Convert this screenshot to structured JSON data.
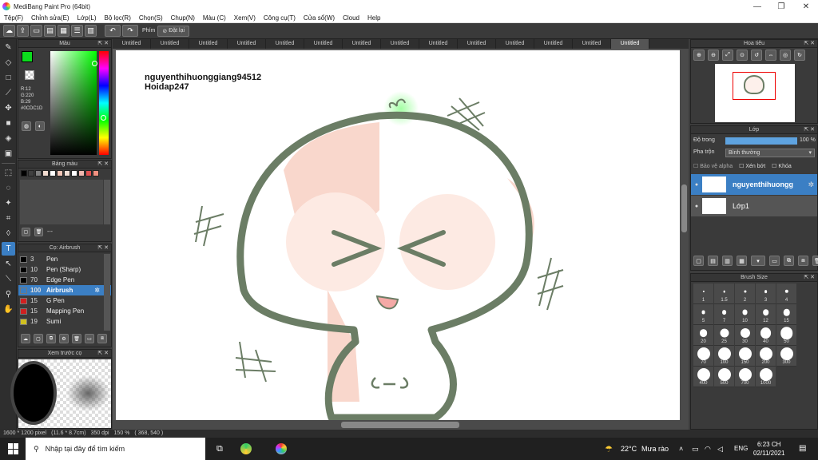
{
  "window": {
    "title": "MediBang Paint Pro (64bit)"
  },
  "menu": [
    "Tệp(F)",
    "Chỉnh sửa(E)",
    "Lớp(L)",
    "Bộ lọc(R)",
    "Chọn(S)",
    "Chụp(N)",
    "Màu (C)",
    "Xem(V)",
    "Công cụ(T)",
    "Cửa sổ(W)",
    "Cloud",
    "Help"
  ],
  "toolbar": {
    "phim_label": "Phím",
    "reset_label": "Đặt lại"
  },
  "doc_tabs": [
    "Untitled",
    "Untitled",
    "Untitled",
    "Untitled",
    "Untitled",
    "Untitled",
    "Untitled",
    "Untitled",
    "Untitled",
    "Untitled",
    "Untitled",
    "Untitled",
    "Untitled",
    "Untitled"
  ],
  "color_panel": {
    "title": "Màu",
    "r": "R:12",
    "g": "G:220",
    "b": "B:29",
    "hex": "#0CDC1D",
    "fg_color": "#0cdc1d"
  },
  "palette_panel": {
    "title": "Bảng màu",
    "field": "---",
    "swatches": [
      "#000000",
      "#404040",
      "#808080",
      "#f2dcd0",
      "#ffffff",
      "#f5c7b8",
      "#f3e0d6",
      "#ffffff",
      "#f0b8b0",
      "#e05050",
      "#f09080"
    ]
  },
  "brush_panel": {
    "title": "Cọ: Airbrush",
    "items": [
      {
        "size": "3",
        "name": "Pen",
        "color": "#000000"
      },
      {
        "size": "10",
        "name": "Pen (Sharp)",
        "color": "#000000"
      },
      {
        "size": "70",
        "name": "Edge Pen",
        "color": "#000000"
      },
      {
        "size": "100",
        "name": "Airbrush",
        "color": "#3b7fc4"
      },
      {
        "size": "15",
        "name": "G Pen",
        "color": "#d02020"
      },
      {
        "size": "15",
        "name": "Mapping Pen",
        "color": "#d02020"
      },
      {
        "size": "19",
        "name": "Sumi",
        "color": "#d0c020"
      }
    ]
  },
  "preview_panel": {
    "title": "Xem trước cọ"
  },
  "canvas": {
    "text_line1": "nguyenthihuonggiang94512",
    "text_line2": "Hoidap247"
  },
  "navigator": {
    "title": "Hoa tiêu"
  },
  "layer_panel": {
    "title": "Lớp",
    "opacity_label": "Độ trong",
    "opacity_value": "100 %",
    "opacity": 1.0,
    "blend_label": "Pha trộn",
    "blend_value": "Bình thường",
    "protect_alpha": "Bảo vệ alpha",
    "clipping": "Xén bớt",
    "lock": "Khóa",
    "layers": [
      {
        "name": "nguyenthihuongg"
      },
      {
        "name": "Lớp1"
      }
    ]
  },
  "brush_size_panel": {
    "title": "Brush Size",
    "sizes": [
      "1",
      "1.5",
      "2",
      "3",
      "4",
      "5",
      "7",
      "10",
      "12",
      "15",
      "20",
      "25",
      "30",
      "40",
      "50",
      "70",
      "100",
      "150",
      "200",
      "300",
      "400",
      "500",
      "700",
      "1000"
    ]
  },
  "status": {
    "size": "1600 * 1200 pixel",
    "cm": "(11.6 * 8.7cm)",
    "dpi": "350 dpi",
    "zoom": "150 %",
    "pos": "( 368, 540 )"
  },
  "taskbar": {
    "search": "Nhập tại đây để tìm kiếm",
    "temp": "22°C",
    "weather": "Mưa rào",
    "lang": "ENG",
    "time": "6:23 CH",
    "date": "02/11/2021"
  }
}
